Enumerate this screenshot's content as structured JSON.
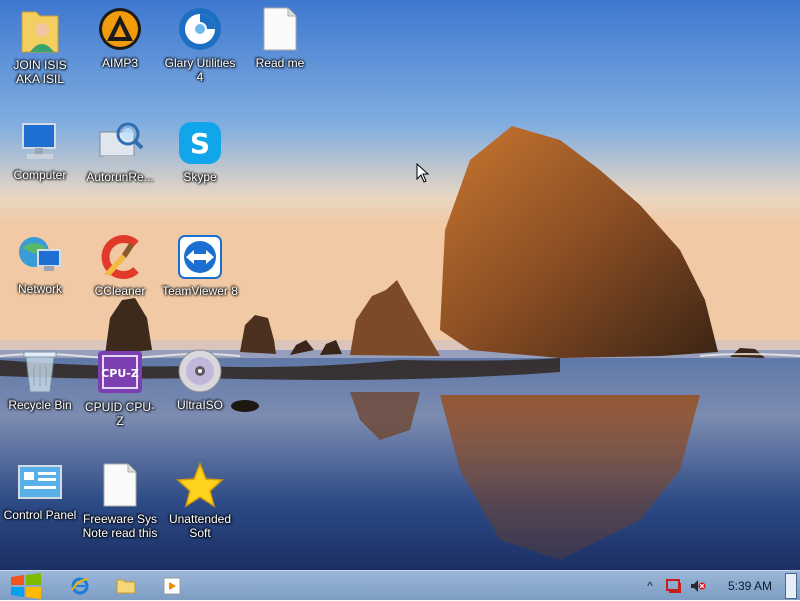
{
  "desktop": {
    "icons": [
      {
        "label": "JOIN ISIS AKA ISIL",
        "icon": "user-folder-icon"
      },
      {
        "label": "AIMP3",
        "icon": "aimp-icon"
      },
      {
        "label": "Glary Utilities 4",
        "icon": "glary-utilities-icon"
      },
      {
        "label": "Read me",
        "icon": "text-document-icon"
      },
      {
        "label": "Computer",
        "icon": "computer-icon"
      },
      {
        "label": "AutorunRe...",
        "icon": "autorun-icon"
      },
      {
        "label": "Skype",
        "icon": "skype-icon"
      },
      {
        "label": "Network",
        "icon": "network-icon"
      },
      {
        "label": "CCleaner",
        "icon": "ccleaner-icon"
      },
      {
        "label": "TeamViewer 8",
        "icon": "teamviewer-icon"
      },
      {
        "label": "Recycle Bin",
        "icon": "recycle-bin-icon"
      },
      {
        "label": "CPUID CPU-Z",
        "icon": "cpuz-icon"
      },
      {
        "label": "UltraISO",
        "icon": "disc-icon"
      },
      {
        "label": "Control Panel",
        "icon": "control-panel-icon"
      },
      {
        "label": "Freeware Sys Note read this",
        "icon": "text-document-icon"
      },
      {
        "label": "Unattended Soft",
        "icon": "star-icon"
      }
    ]
  },
  "taskbar": {
    "start": {
      "icon": "windows-logo-icon"
    },
    "pinned": [
      {
        "icon": "internet-explorer-icon"
      },
      {
        "icon": "file-explorer-icon"
      },
      {
        "icon": "media-player-icon"
      }
    ],
    "tray": {
      "chevron": "^",
      "icons": [
        "action-center-icon",
        "volume-muted-icon"
      ],
      "time": "5:39 AM"
    }
  },
  "colors": {
    "taskbar": "#8aa9cf",
    "sky_top": "#3e78d0",
    "sea": "#1f3f7a"
  }
}
